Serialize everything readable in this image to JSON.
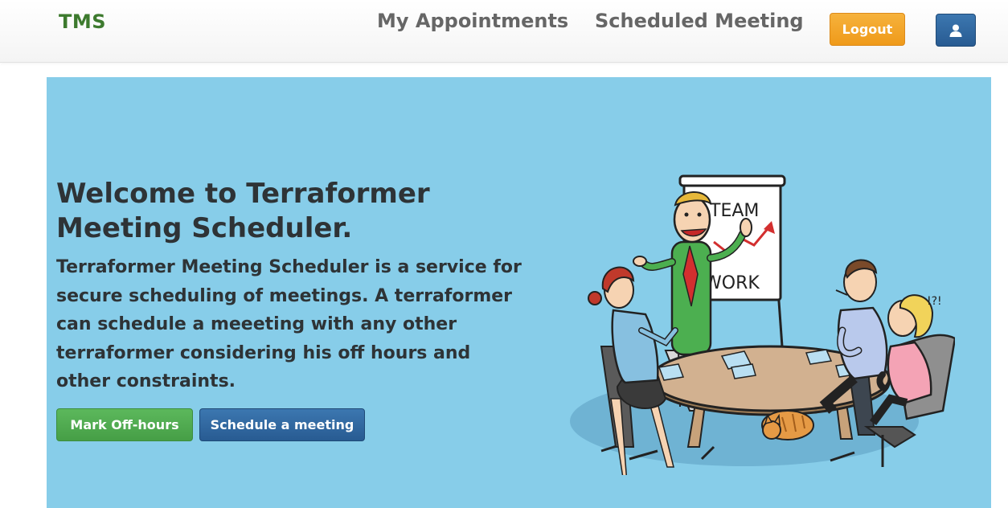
{
  "navbar": {
    "brand": "TMS",
    "links": [
      {
        "label": "My Appointments"
      },
      {
        "label": "Scheduled Meeting"
      }
    ],
    "logout_label": "Logout",
    "user_icon": "user-icon"
  },
  "hero": {
    "title": "Welcome to Terraformer Meeting Scheduler.",
    "description": "Terraformer Meeting Scheduler is a service for secure scheduling of meetings. A terraformer can schedule a meeeting with any other terraformer considering his off hours and other constraints.",
    "buttons": {
      "offhours_label": "Mark Off-hours",
      "schedule_label": "Schedule a meeting"
    },
    "illustration": {
      "board_line1": "TEAM",
      "board_line2": "WORK",
      "exclamation": "!?!"
    }
  },
  "colors": {
    "brand": "#3d7a2e",
    "jumbotron_bg": "#87cde9",
    "logout": "#f0a030",
    "primary": "#2e6aa3",
    "success": "#52ad52"
  }
}
